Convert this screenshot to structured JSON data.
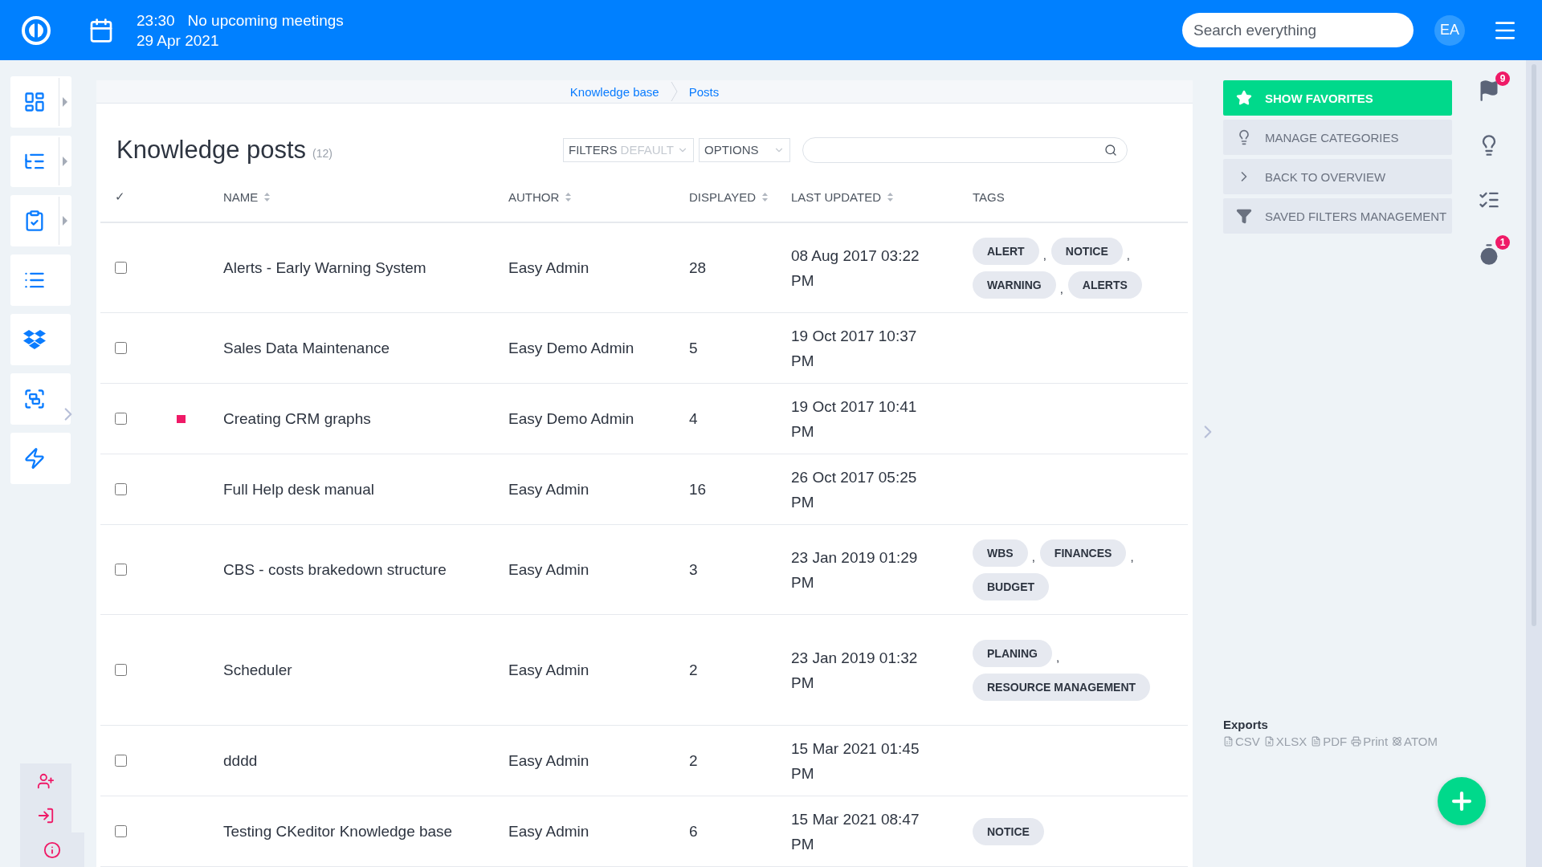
{
  "topbar": {
    "time": "23:30",
    "meetings": "No upcoming meetings",
    "date": "29 Apr 2021",
    "search": {
      "placeholder": "Search everything"
    },
    "avatar": "EA"
  },
  "sidebar": {
    "items": [
      {
        "kind": "dashboard",
        "has_submenu": true
      },
      {
        "kind": "tree",
        "has_submenu": true
      },
      {
        "kind": "tasks",
        "has_submenu": true
      },
      {
        "kind": "list",
        "has_submenu": false
      },
      {
        "kind": "dropbox",
        "has_submenu": false
      },
      {
        "kind": "frames",
        "has_submenu": false
      },
      {
        "kind": "bolt",
        "has_submenu": false
      }
    ],
    "bottom_items": [
      {
        "kind": "add-user"
      },
      {
        "kind": "sign-in"
      },
      {
        "kind": "info"
      }
    ]
  },
  "breadcrumb": [
    "Knowledge base",
    "Posts"
  ],
  "title": "Knowledge posts",
  "count": "(12)",
  "filters": {
    "label": "FILTERS",
    "value": "DEFAULT"
  },
  "options": "OPTIONS",
  "table": {
    "columns": [
      {
        "label": "✓",
        "sortable": false
      },
      {
        "label": "NAME",
        "sortable": true
      },
      {
        "label": "AUTHOR",
        "sortable": true
      },
      {
        "label": "DISPLAYED",
        "sortable": true
      },
      {
        "label": "LAST UPDATED",
        "sortable": true
      },
      {
        "label": "TAGS",
        "sortable": false
      }
    ],
    "tag_separator": ",",
    "rows": [
      {
        "checked": false,
        "flagged": false,
        "name": "Alerts - Early Warning System",
        "author": "Easy Admin",
        "displayed": "28",
        "updated": "08 Aug 2017 03:22 PM",
        "tags": [
          "ALERT",
          "NOTICE",
          "WARNING",
          "ALERTS"
        ]
      },
      {
        "checked": false,
        "flagged": false,
        "name": "Sales Data Maintenance",
        "author": "Easy Demo Admin",
        "displayed": "5",
        "updated": "19 Oct 2017 10:37 PM",
        "tags": []
      },
      {
        "checked": false,
        "flagged": true,
        "name": "Creating CRM graphs",
        "author": "Easy Demo Admin",
        "displayed": "4",
        "updated": "19 Oct 2017 10:41 PM",
        "tags": []
      },
      {
        "checked": false,
        "flagged": false,
        "name": "Full Help desk manual",
        "author": "Easy Admin",
        "displayed": "16",
        "updated": "26 Oct 2017 05:25 PM",
        "tags": []
      },
      {
        "checked": false,
        "flagged": false,
        "name": "CBS - costs brakedown structure",
        "author": "Easy Admin",
        "displayed": "3",
        "updated": "23 Jan 2019 01:29 PM",
        "tags": [
          "WBS",
          "FINANCES",
          "BUDGET"
        ]
      },
      {
        "checked": false,
        "flagged": false,
        "name": "Scheduler",
        "author": "Easy Admin",
        "displayed": "2",
        "updated": "23 Jan 2019 01:32 PM",
        "tags": [
          "PLANING",
          "RESOURCE MANAGEMENT"
        ]
      },
      {
        "checked": false,
        "flagged": false,
        "name": "dddd",
        "author": "Easy Admin",
        "displayed": "2",
        "updated": "15 Mar 2021 01:45 PM",
        "tags": []
      },
      {
        "checked": false,
        "flagged": false,
        "name": "Testing CKeditor Knowledge base",
        "author": "Easy Admin",
        "displayed": "6",
        "updated": "15 Mar 2021 08:47 PM",
        "tags": [
          "NOTICE"
        ]
      }
    ]
  },
  "actions": [
    {
      "kind": "star",
      "label": "SHOW FAVORITES",
      "highlighted": true
    },
    {
      "kind": "bulb",
      "label": "MANAGE CATEGORIES",
      "highlighted": false
    },
    {
      "kind": "chevron",
      "label": "BACK TO OVERVIEW",
      "highlighted": false
    },
    {
      "kind": "filter",
      "label": "SAVED FILTERS MANAGEMENT",
      "highlighted": false
    }
  ],
  "exports": {
    "title": "Exports",
    "items": [
      {
        "kind": "csv",
        "label": "CSV"
      },
      {
        "kind": "xlsx",
        "label": "XLSX"
      },
      {
        "kind": "pdf",
        "label": "PDF"
      },
      {
        "kind": "print",
        "label": "Print"
      },
      {
        "kind": "atom",
        "label": "ATOM"
      }
    ]
  },
  "side_icons": [
    {
      "kind": "flag",
      "badge": "9"
    },
    {
      "kind": "bulb"
    },
    {
      "kind": "checklist"
    },
    {
      "kind": "timer",
      "badge": "1"
    }
  ]
}
